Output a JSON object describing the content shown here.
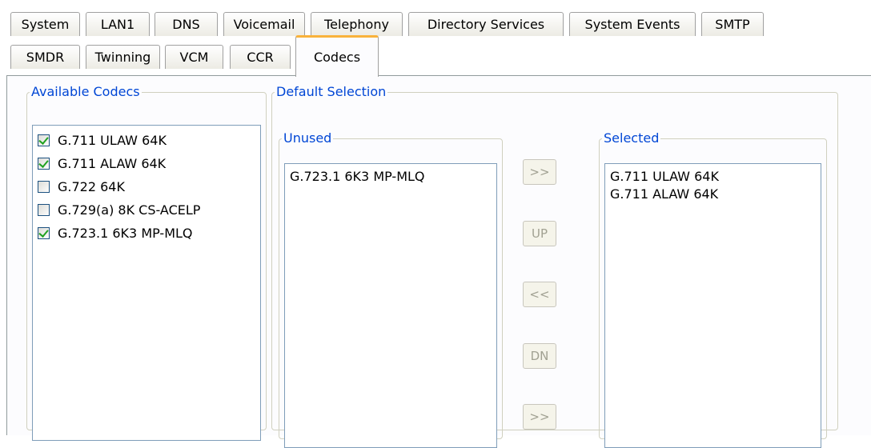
{
  "tabs_row1": [
    "System",
    "LAN1",
    "DNS",
    "Voicemail",
    "Telephony",
    "Directory Services",
    "System Events",
    "SMTP"
  ],
  "tabs_row2": [
    "SMDR",
    "Twinning",
    "VCM",
    "CCR",
    "Codecs"
  ],
  "active_tab": "Codecs",
  "available_codecs": {
    "legend": "Available Codecs",
    "items": [
      {
        "label": "G.711 ULAW 64K",
        "checked": true
      },
      {
        "label": "G.711 ALAW 64K",
        "checked": true
      },
      {
        "label": "G.722 64K",
        "checked": false
      },
      {
        "label": "G.729(a) 8K CS-ACELP",
        "checked": false
      },
      {
        "label": "G.723.1 6K3 MP-MLQ",
        "checked": true
      }
    ]
  },
  "default_selection": {
    "legend": "Default Selection",
    "unused": {
      "legend": "Unused",
      "items": [
        "G.723.1 6K3 MP-MLQ"
      ]
    },
    "selected": {
      "legend": "Selected",
      "items": [
        "G.711 ULAW 64K",
        "G.711 ALAW 64K"
      ]
    },
    "buttons": {
      "add": ">>",
      "up": "UP",
      "remove": "<<",
      "down": "DN",
      "add_all": ">>"
    }
  }
}
